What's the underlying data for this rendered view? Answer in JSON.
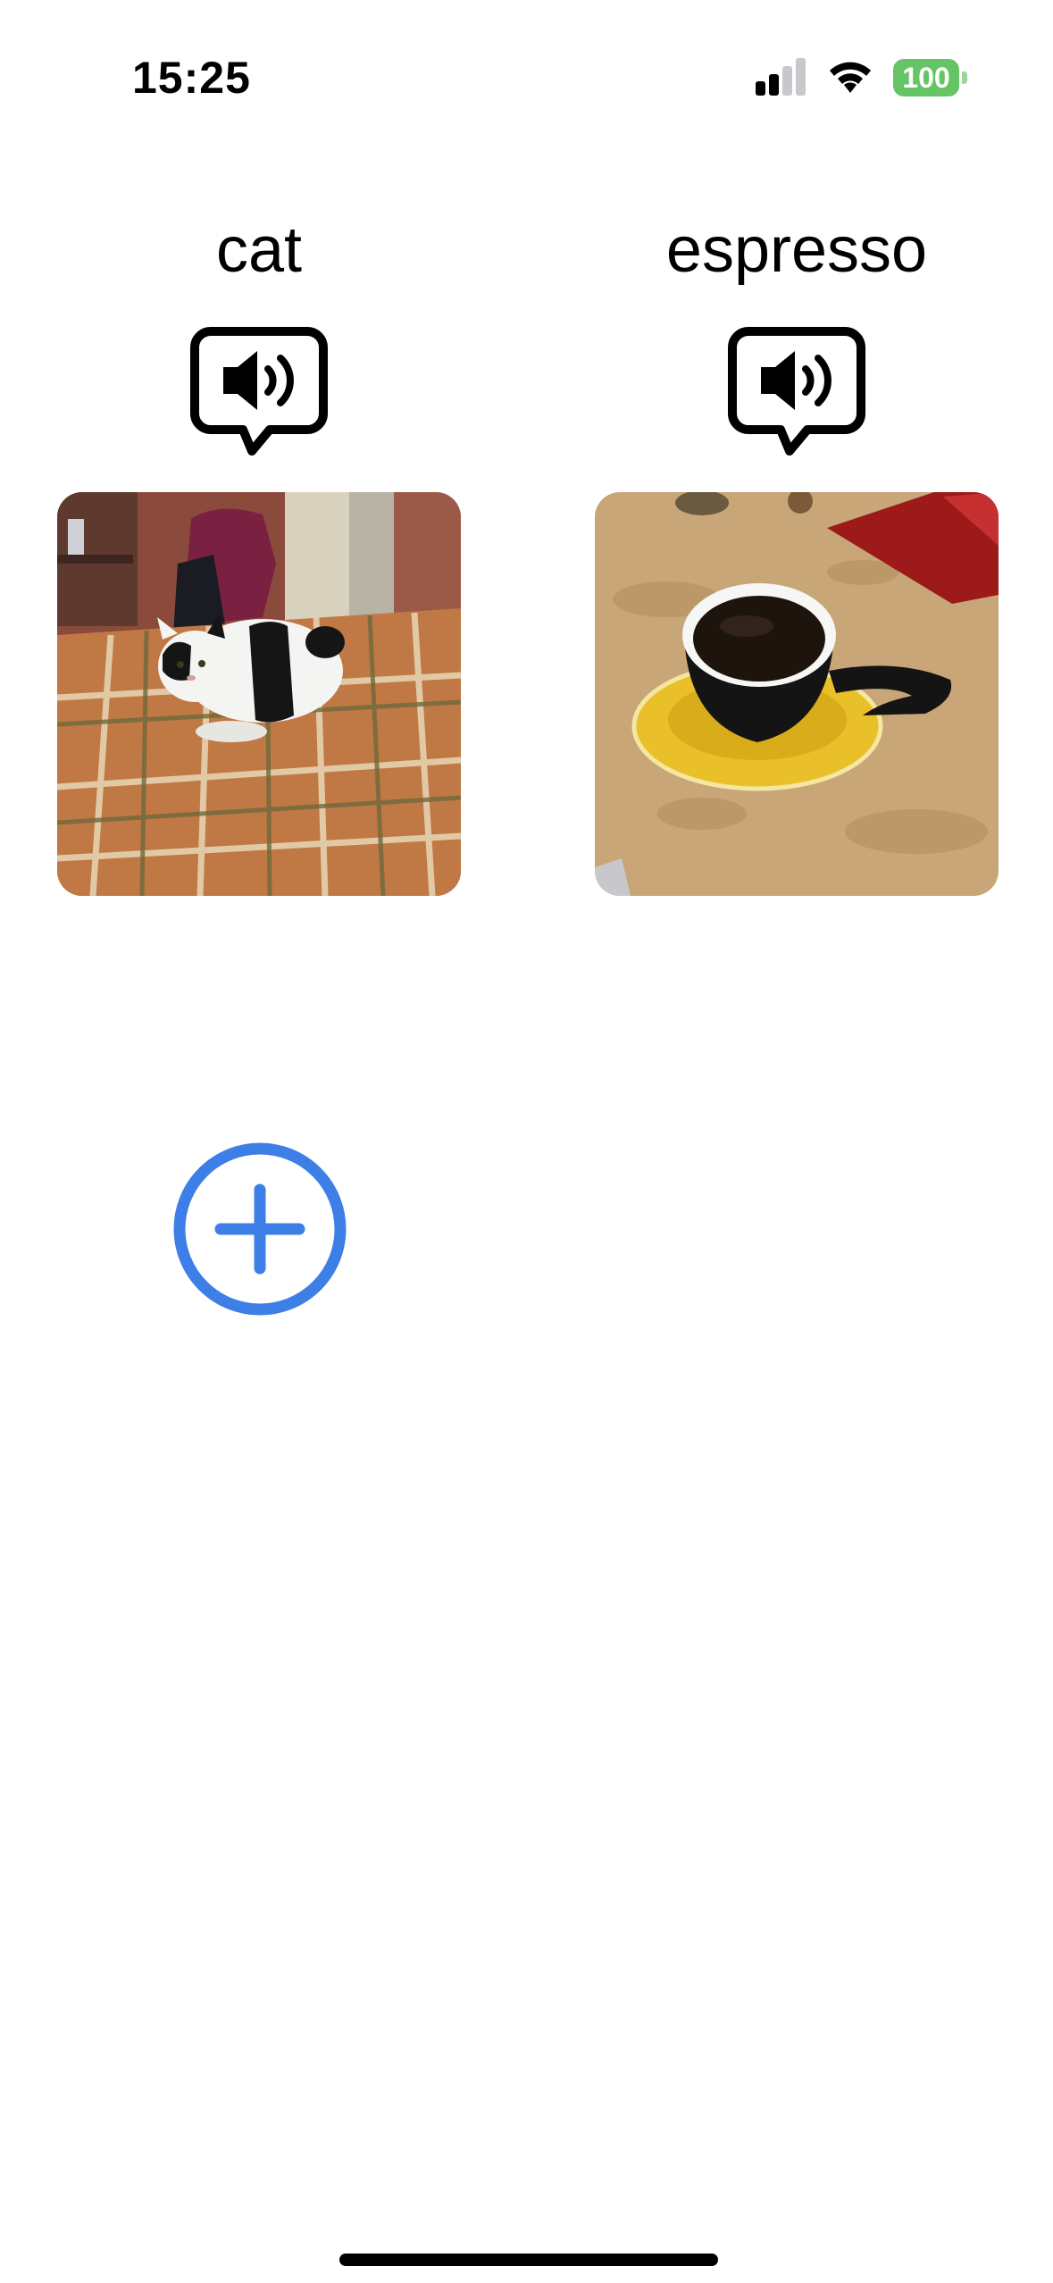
{
  "status_bar": {
    "time": "15:25",
    "battery_level": "100",
    "icons": [
      "cellular-signal-icon",
      "wifi-icon",
      "battery-icon"
    ]
  },
  "cards": [
    {
      "label": "cat",
      "image": "photo of a black-and-white cat lying on a plaid blanket",
      "speaker_icon": "speaker-bubble-icon"
    },
    {
      "label": "espresso",
      "image": "photo of an espresso cup on a yellow saucer",
      "speaker_icon": "speaker-bubble-icon"
    }
  ],
  "add_button": {
    "icon": "plus-circle-icon"
  },
  "colors": {
    "accent": "#3d7fe6",
    "battery": "#65c466",
    "background": "#ffffff"
  }
}
